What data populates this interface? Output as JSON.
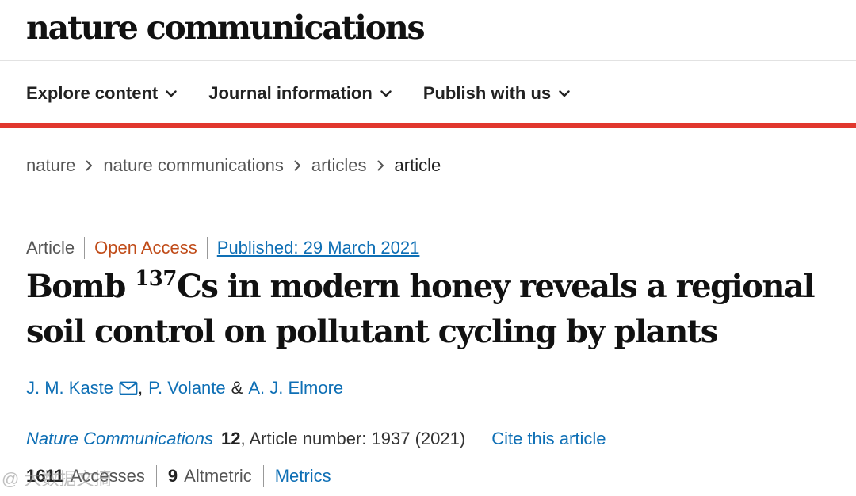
{
  "header": {
    "brand": "nature communications"
  },
  "nav": {
    "items": [
      {
        "label": "Explore content"
      },
      {
        "label": "Journal information"
      },
      {
        "label": "Publish with us"
      }
    ]
  },
  "breadcrumb": {
    "items": [
      "nature",
      "nature communications",
      "articles",
      "article"
    ]
  },
  "article_meta": {
    "type": "Article",
    "access": "Open Access",
    "published": "Published: 29 March 2021"
  },
  "title": {
    "part1": "Bomb ",
    "superscript": "137",
    "part2": "Cs in modern honey reveals a regional soil control on pollutant cycling by plants"
  },
  "authors": {
    "a1": "J. M. Kaste",
    "sep1": ",",
    "a2": "P. Volante",
    "sep2": "&",
    "a3": "A. J. Elmore"
  },
  "citation": {
    "journal": "Nature Communications",
    "volume": "12",
    "details": ", Article number: 1937 (2021)",
    "cite_link": "Cite this article"
  },
  "metrics": {
    "accesses_count": "1611",
    "accesses_label": "Accesses",
    "altmetric_count": "9",
    "altmetric_label": "Altmetric",
    "metrics_link": "Metrics"
  },
  "watermark": {
    "text": "@ 大数据文摘"
  },
  "colors": {
    "accent_red": "#e1372e",
    "link_blue": "#0e6fb5",
    "open_access_orange": "#c04b18"
  }
}
